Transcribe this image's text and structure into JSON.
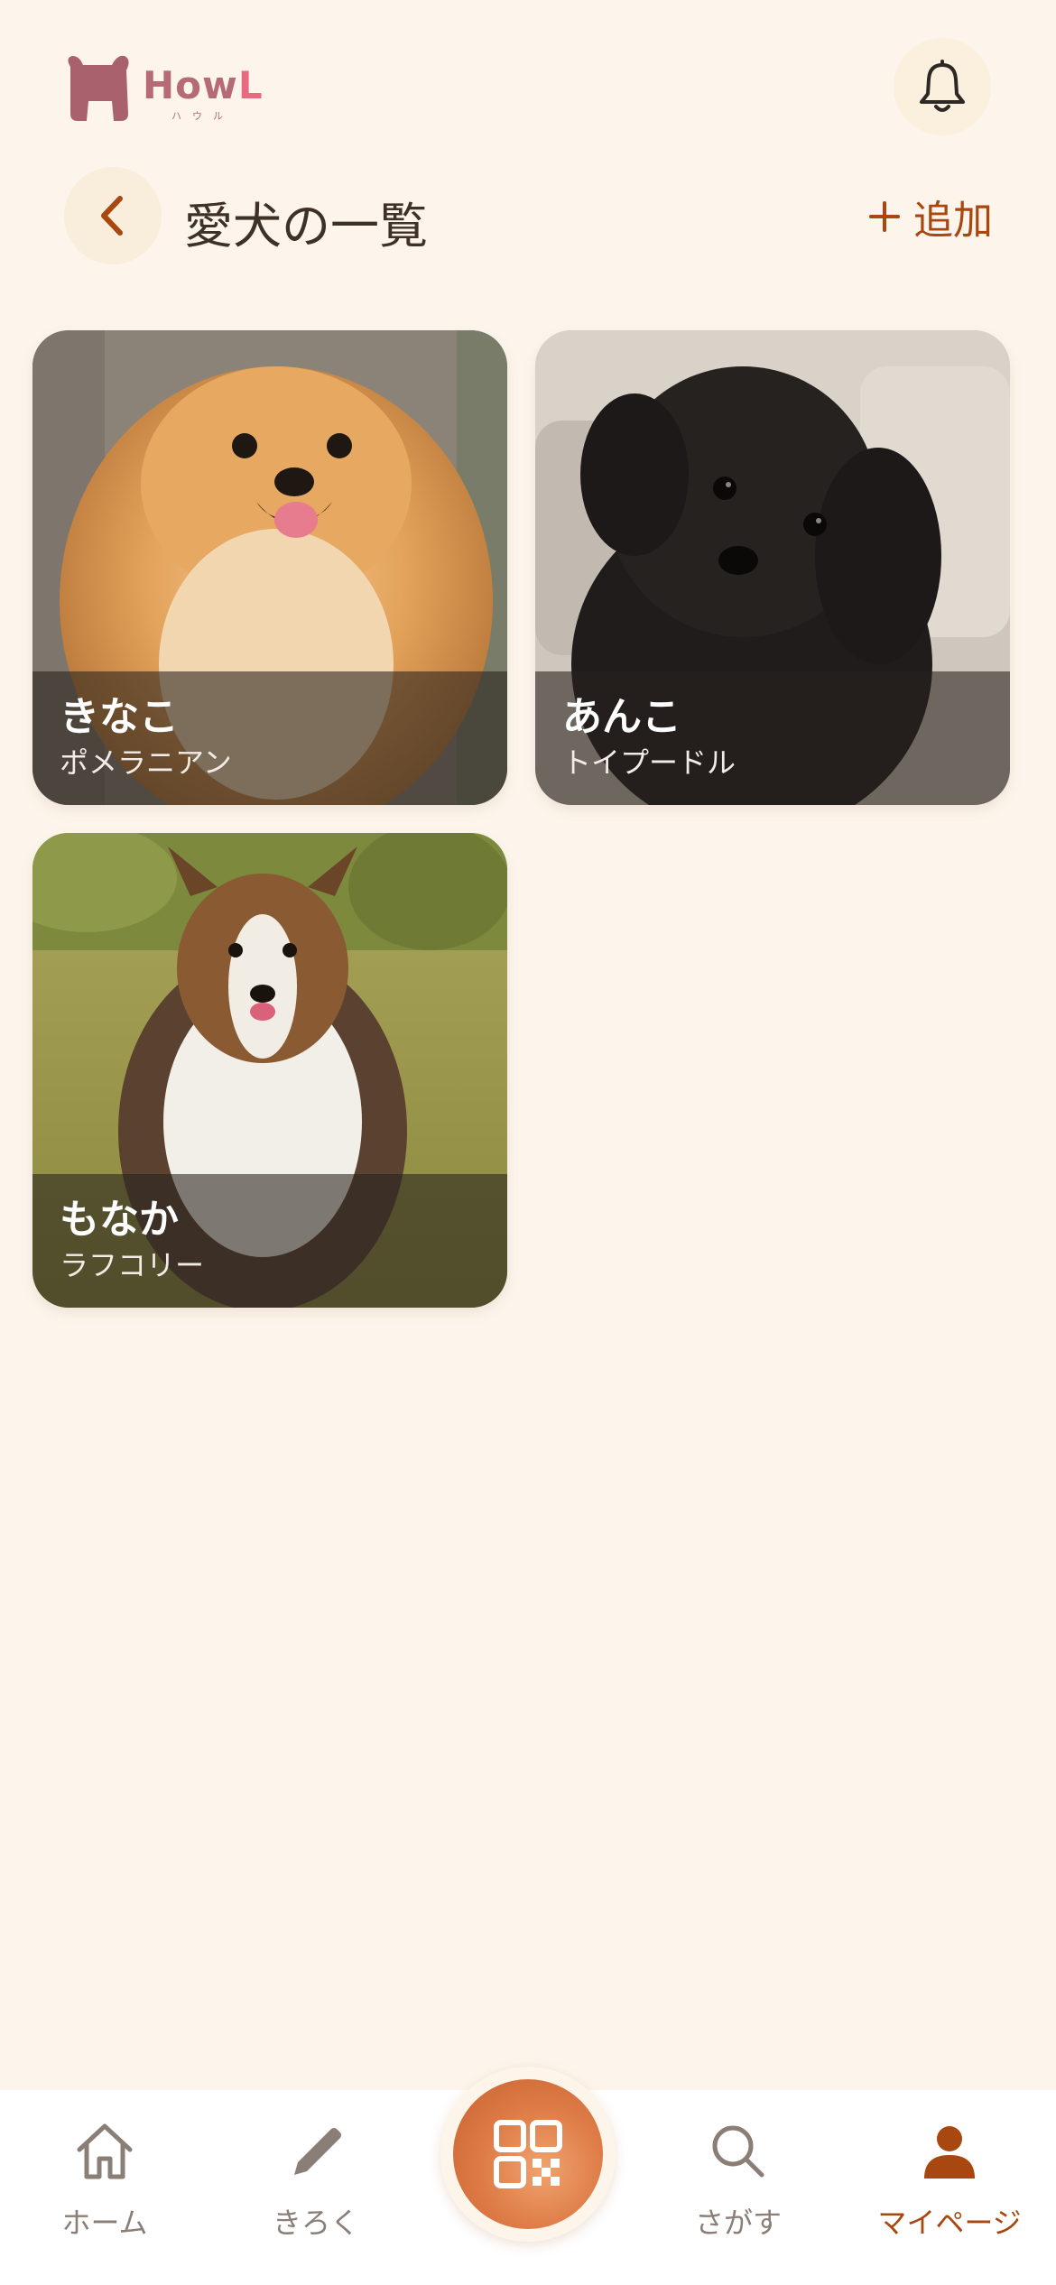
{
  "header": {
    "logo_text_main": "How",
    "logo_text_l": "L",
    "logo_sub": "ハウル"
  },
  "title_bar": {
    "title": "愛犬の一覧",
    "add_label": "追加"
  },
  "dogs": [
    {
      "name": "きなこ",
      "breed": "ポメラニアン"
    },
    {
      "name": "あんこ",
      "breed": "トイプードル"
    },
    {
      "name": "もなか",
      "breed": "ラフコリー"
    }
  ],
  "nav": {
    "items": [
      {
        "label": "ホーム",
        "icon": "home-icon",
        "active": false
      },
      {
        "label": "きろく",
        "icon": "pencil-icon",
        "active": false
      },
      {
        "label": "さがす",
        "icon": "search-icon",
        "active": false
      },
      {
        "label": "マイページ",
        "icon": "person-icon",
        "active": true
      }
    ],
    "center_icon": "qr-code-icon"
  },
  "colors": {
    "background": "#FDF5EC",
    "accent": "#A8470F",
    "qr_button": "#DD7A45",
    "logo": "#B56A75"
  }
}
